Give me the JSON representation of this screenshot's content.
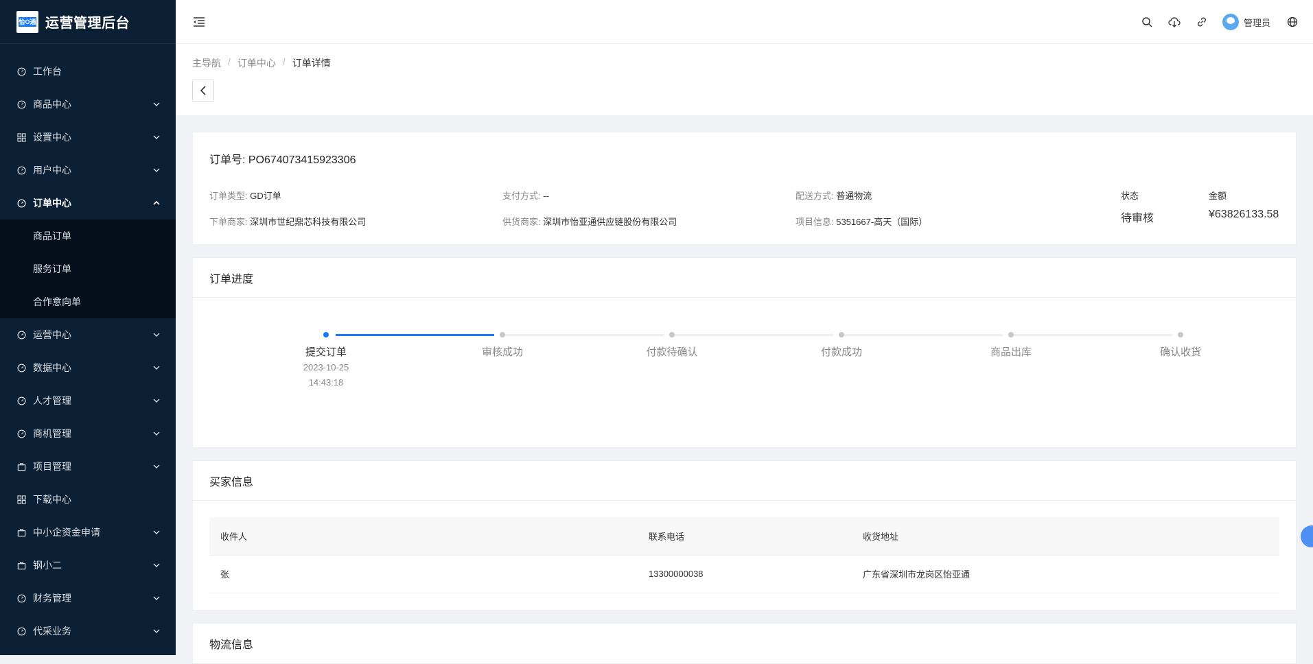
{
  "brand": {
    "logo_text": "怡O通",
    "title": "运营管理后台"
  },
  "sidebar": {
    "items": [
      {
        "label": "工作台",
        "icon": "dashboard-icon"
      },
      {
        "label": "商品中心",
        "icon": "dashboard-icon"
      },
      {
        "label": "设置中心",
        "icon": "grid-icon"
      },
      {
        "label": "用户中心",
        "icon": "dashboard-icon"
      },
      {
        "label": "订单中心",
        "icon": "dashboard-icon"
      },
      {
        "label": "运营中心",
        "icon": "dashboard-icon"
      },
      {
        "label": "数据中心",
        "icon": "dashboard-icon"
      },
      {
        "label": "人才管理",
        "icon": "dashboard-icon"
      },
      {
        "label": "商机管理",
        "icon": "dashboard-icon"
      },
      {
        "label": "项目管理",
        "icon": "briefcase-icon"
      },
      {
        "label": "下载中心",
        "icon": "grid-icon"
      },
      {
        "label": "中小企资金申请",
        "icon": "briefcase-icon"
      },
      {
        "label": "钢小二",
        "icon": "briefcase-icon"
      },
      {
        "label": "财务管理",
        "icon": "dashboard-icon"
      },
      {
        "label": "代采业务",
        "icon": "dashboard-icon"
      }
    ],
    "order_sub": [
      "商品订单",
      "服务订单",
      "合作意向单"
    ]
  },
  "topbar": {
    "user_name": "管理员"
  },
  "breadcrumb": [
    "主导航",
    "订单中心",
    "订单详情"
  ],
  "order": {
    "no_label": "订单号:",
    "no": "PO674073415923306",
    "type_label": "订单类型:",
    "type": "GD订单",
    "pay_label": "支付方式:",
    "pay": "--",
    "ship_label": "配送方式:",
    "ship": "普通物流",
    "merchant_label": "下单商家:",
    "merchant": "深圳市世纪鼎芯科技有限公司",
    "supplier_label": "供货商家:",
    "supplier": "深圳市怡亚通供应链股份有限公司",
    "project_label": "项目信息:",
    "project": "5351667-高天（国际）",
    "status_label": "状态",
    "status": "待审核",
    "amount_label": "金额",
    "amount": "¥63826133.58"
  },
  "progress": {
    "title": "订单进度",
    "steps": [
      {
        "label": "提交订单",
        "date": "2023-10-25",
        "time": "14:43:18",
        "done": true
      },
      {
        "label": "审核成功",
        "done": false
      },
      {
        "label": "付款待确认",
        "done": false
      },
      {
        "label": "付款成功",
        "done": false
      },
      {
        "label": "商品出库",
        "done": false
      },
      {
        "label": "确认收货",
        "done": false
      }
    ]
  },
  "buyer": {
    "title": "买家信息",
    "headers": [
      "收件人",
      "联系电话",
      "收货地址"
    ],
    "row": [
      "张",
      "13300000038",
      "广东省深圳市龙岗区怡亚通"
    ]
  },
  "logistics": {
    "title": "物流信息"
  },
  "colors": {
    "sidebar_bg": "#0b1f35",
    "submenu_bg": "#050f1c",
    "primary": "#1677ff"
  }
}
